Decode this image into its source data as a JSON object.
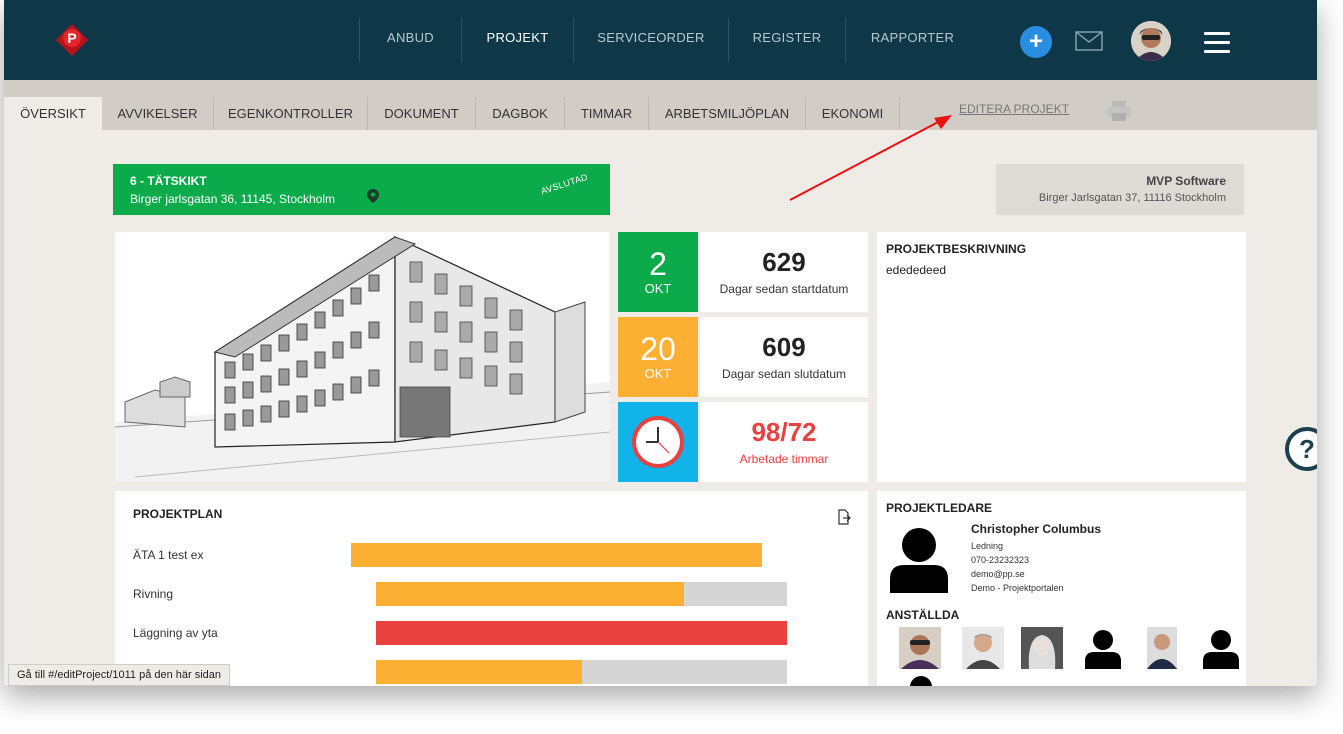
{
  "nav": {
    "items": [
      "ANBUD",
      "PROJEKT",
      "SERVICEORDER",
      "REGISTER",
      "RAPPORTER"
    ],
    "active": "PROJEKT"
  },
  "header": {
    "add_label": "+"
  },
  "tabs": {
    "items": [
      "ÖVERSIKT",
      "AVVIKELSER",
      "EGENKONTROLLER",
      "DOKUMENT",
      "DAGBOK",
      "TIMMAR",
      "ARBETSMILJÖPLAN",
      "EKONOMI"
    ],
    "active": "ÖVERSIKT"
  },
  "edit_project_label": "EDITERA PROJEKT",
  "project": {
    "name": "6 - TÄTSKIKT",
    "address": "Birger jarlsgatan 36, 11145, Stockholm",
    "status": "AVSLUTAD"
  },
  "company": {
    "name": "MVP Software",
    "address": "Birger Jarlsgatan 37, 11116 Stockholm"
  },
  "stats": {
    "start": {
      "day": "2",
      "month": "OKT",
      "value": "629",
      "label": "Dagar sedan startdatum"
    },
    "end": {
      "day": "20",
      "month": "OKT",
      "value": "609",
      "label": "Dagar sedan slutdatum"
    },
    "hours": {
      "value": "98/72",
      "label": "Arbetade timmar"
    }
  },
  "description": {
    "title": "PROJEKTBESKRIVNING",
    "text": "edededeed"
  },
  "plan": {
    "title": "PROJEKTPLAN",
    "rows": [
      {
        "label": "ÄTA 1 test ex",
        "color": "#fbb034",
        "progress": 1.0
      },
      {
        "label": "Rivning",
        "color": "#fbb034",
        "progress": 0.75
      },
      {
        "label": "Läggning av yta",
        "color": "#e94040",
        "progress": 1.0
      },
      {
        "label": "",
        "color": "#fbb034",
        "progress": 0.5
      }
    ]
  },
  "manager": {
    "title": "PROJEKTLEDARE",
    "name": "Christopher Columbus",
    "role": "Ledning",
    "phone": "070-23232323",
    "email": "demo@pp.se",
    "org": "Demo - Projektportalen"
  },
  "employees_title": "ANSTÄLLDA",
  "status_bar": "Gå till #/editProject/1011 på den här sidan",
  "colors": {
    "topbar": "#0e3847",
    "green": "#0bab4b",
    "orange": "#fbb034",
    "red": "#e94040",
    "blue": "#12b3e8"
  }
}
